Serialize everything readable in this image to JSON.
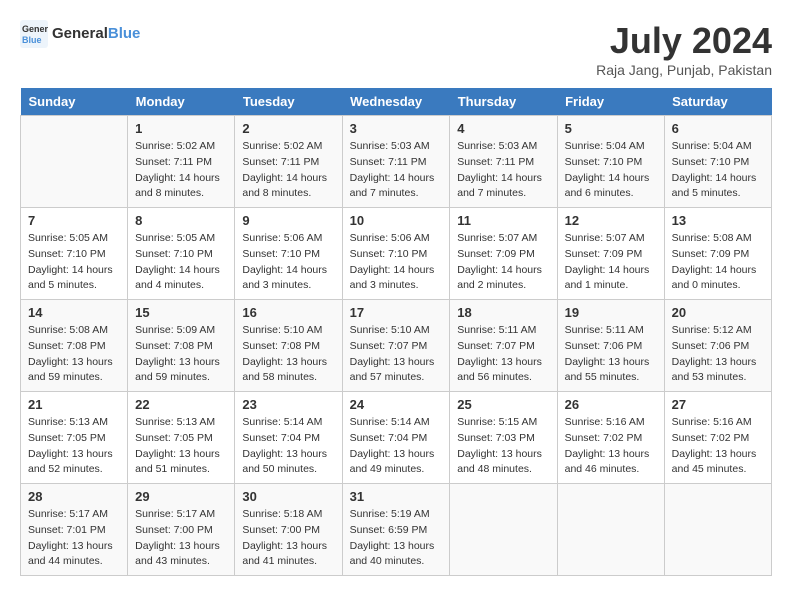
{
  "header": {
    "logo_line1": "General",
    "logo_line2": "Blue",
    "title": "July 2024",
    "location": "Raja Jang, Punjab, Pakistan"
  },
  "columns": [
    "Sunday",
    "Monday",
    "Tuesday",
    "Wednesday",
    "Thursday",
    "Friday",
    "Saturday"
  ],
  "weeks": [
    [
      {
        "day": "",
        "info": ""
      },
      {
        "day": "1",
        "info": "Sunrise: 5:02 AM\nSunset: 7:11 PM\nDaylight: 14 hours\nand 8 minutes."
      },
      {
        "day": "2",
        "info": "Sunrise: 5:02 AM\nSunset: 7:11 PM\nDaylight: 14 hours\nand 8 minutes."
      },
      {
        "day": "3",
        "info": "Sunrise: 5:03 AM\nSunset: 7:11 PM\nDaylight: 14 hours\nand 7 minutes."
      },
      {
        "day": "4",
        "info": "Sunrise: 5:03 AM\nSunset: 7:11 PM\nDaylight: 14 hours\nand 7 minutes."
      },
      {
        "day": "5",
        "info": "Sunrise: 5:04 AM\nSunset: 7:10 PM\nDaylight: 14 hours\nand 6 minutes."
      },
      {
        "day": "6",
        "info": "Sunrise: 5:04 AM\nSunset: 7:10 PM\nDaylight: 14 hours\nand 5 minutes."
      }
    ],
    [
      {
        "day": "7",
        "info": "Sunrise: 5:05 AM\nSunset: 7:10 PM\nDaylight: 14 hours\nand 5 minutes."
      },
      {
        "day": "8",
        "info": "Sunrise: 5:05 AM\nSunset: 7:10 PM\nDaylight: 14 hours\nand 4 minutes."
      },
      {
        "day": "9",
        "info": "Sunrise: 5:06 AM\nSunset: 7:10 PM\nDaylight: 14 hours\nand 3 minutes."
      },
      {
        "day": "10",
        "info": "Sunrise: 5:06 AM\nSunset: 7:10 PM\nDaylight: 14 hours\nand 3 minutes."
      },
      {
        "day": "11",
        "info": "Sunrise: 5:07 AM\nSunset: 7:09 PM\nDaylight: 14 hours\nand 2 minutes."
      },
      {
        "day": "12",
        "info": "Sunrise: 5:07 AM\nSunset: 7:09 PM\nDaylight: 14 hours\nand 1 minute."
      },
      {
        "day": "13",
        "info": "Sunrise: 5:08 AM\nSunset: 7:09 PM\nDaylight: 14 hours\nand 0 minutes."
      }
    ],
    [
      {
        "day": "14",
        "info": "Sunrise: 5:08 AM\nSunset: 7:08 PM\nDaylight: 13 hours\nand 59 minutes."
      },
      {
        "day": "15",
        "info": "Sunrise: 5:09 AM\nSunset: 7:08 PM\nDaylight: 13 hours\nand 59 minutes."
      },
      {
        "day": "16",
        "info": "Sunrise: 5:10 AM\nSunset: 7:08 PM\nDaylight: 13 hours\nand 58 minutes."
      },
      {
        "day": "17",
        "info": "Sunrise: 5:10 AM\nSunset: 7:07 PM\nDaylight: 13 hours\nand 57 minutes."
      },
      {
        "day": "18",
        "info": "Sunrise: 5:11 AM\nSunset: 7:07 PM\nDaylight: 13 hours\nand 56 minutes."
      },
      {
        "day": "19",
        "info": "Sunrise: 5:11 AM\nSunset: 7:06 PM\nDaylight: 13 hours\nand 55 minutes."
      },
      {
        "day": "20",
        "info": "Sunrise: 5:12 AM\nSunset: 7:06 PM\nDaylight: 13 hours\nand 53 minutes."
      }
    ],
    [
      {
        "day": "21",
        "info": "Sunrise: 5:13 AM\nSunset: 7:05 PM\nDaylight: 13 hours\nand 52 minutes."
      },
      {
        "day": "22",
        "info": "Sunrise: 5:13 AM\nSunset: 7:05 PM\nDaylight: 13 hours\nand 51 minutes."
      },
      {
        "day": "23",
        "info": "Sunrise: 5:14 AM\nSunset: 7:04 PM\nDaylight: 13 hours\nand 50 minutes."
      },
      {
        "day": "24",
        "info": "Sunrise: 5:14 AM\nSunset: 7:04 PM\nDaylight: 13 hours\nand 49 minutes."
      },
      {
        "day": "25",
        "info": "Sunrise: 5:15 AM\nSunset: 7:03 PM\nDaylight: 13 hours\nand 48 minutes."
      },
      {
        "day": "26",
        "info": "Sunrise: 5:16 AM\nSunset: 7:02 PM\nDaylight: 13 hours\nand 46 minutes."
      },
      {
        "day": "27",
        "info": "Sunrise: 5:16 AM\nSunset: 7:02 PM\nDaylight: 13 hours\nand 45 minutes."
      }
    ],
    [
      {
        "day": "28",
        "info": "Sunrise: 5:17 AM\nSunset: 7:01 PM\nDaylight: 13 hours\nand 44 minutes."
      },
      {
        "day": "29",
        "info": "Sunrise: 5:17 AM\nSunset: 7:00 PM\nDaylight: 13 hours\nand 43 minutes."
      },
      {
        "day": "30",
        "info": "Sunrise: 5:18 AM\nSunset: 7:00 PM\nDaylight: 13 hours\nand 41 minutes."
      },
      {
        "day": "31",
        "info": "Sunrise: 5:19 AM\nSunset: 6:59 PM\nDaylight: 13 hours\nand 40 minutes."
      },
      {
        "day": "",
        "info": ""
      },
      {
        "day": "",
        "info": ""
      },
      {
        "day": "",
        "info": ""
      }
    ]
  ]
}
